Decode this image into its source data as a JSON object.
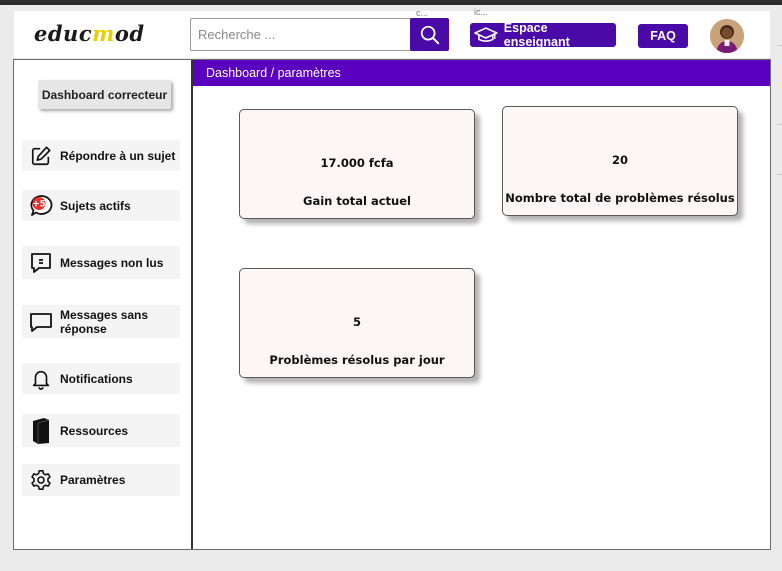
{
  "header": {
    "logo": {
      "part1": "educ",
      "part2": "m",
      "part3": "od"
    },
    "search": {
      "placeholder": "Recherche ...",
      "icon": "search-icon"
    },
    "hint_left": "c...",
    "hint_right": "ic...",
    "teacher_button": "Espace enseignant",
    "faq_button": "FAQ"
  },
  "sidebar": {
    "title": "Dashboard correcteur",
    "items": [
      {
        "label": "Répondre à  un sujet",
        "icon": "edit-icon"
      },
      {
        "label": "Sujets actifs",
        "icon": "chat-badge-icon",
        "badge": "+5"
      },
      {
        "label": "Messages non lus",
        "icon": "message-icon"
      },
      {
        "label": "Messages sans réponse",
        "icon": "message-empty-icon"
      },
      {
        "label": "Notifications",
        "icon": "bell-icon"
      },
      {
        "label": "Ressources",
        "icon": "book-icon"
      },
      {
        "label": "Paramètres",
        "icon": "gear-icon"
      }
    ]
  },
  "main": {
    "breadcrumb": "Dashboard / paramètres",
    "cards": [
      {
        "value": "17.000 fcfa",
        "caption": "Gain total actuel"
      },
      {
        "value": "20",
        "caption": "Nombre total de problèmes résolus"
      },
      {
        "value": "5",
        "caption": "Problèmes résolus par jour"
      }
    ]
  },
  "colors": {
    "primary": "#4a0aa8",
    "breadcrumb_bar": "#5a00bf",
    "card_bg": "#fdf6f6",
    "badge": "#e53030"
  }
}
